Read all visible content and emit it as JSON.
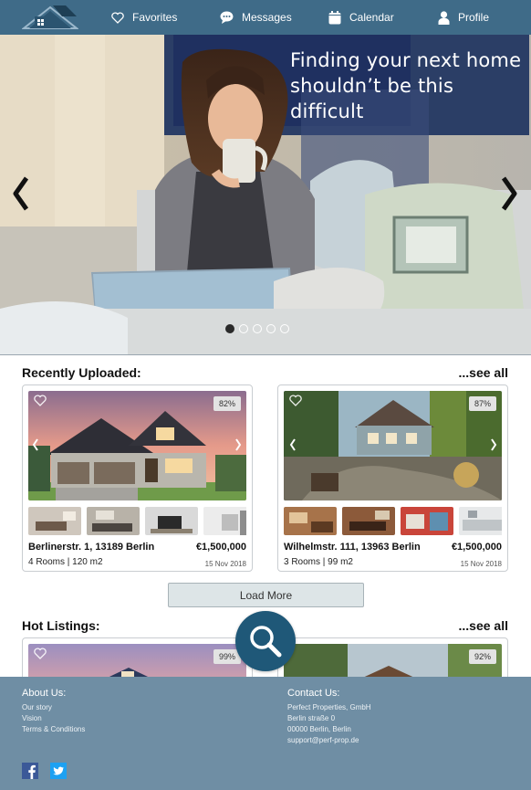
{
  "nav": {
    "items": [
      {
        "label": "Favorites",
        "icon": "heart-icon"
      },
      {
        "label": "Messages",
        "icon": "chat-icon"
      },
      {
        "label": "Calendar",
        "icon": "calendar-icon"
      },
      {
        "label": "Profile",
        "icon": "user-icon"
      }
    ],
    "logo_icon": "house-icon"
  },
  "hero": {
    "title": "Finding your next home shouldn’t be this difficult",
    "slides_total": 5,
    "active_slide": 1,
    "prev_icon": "chevron-left-icon",
    "next_icon": "chevron-right-icon"
  },
  "recent": {
    "title": "Recently Uploaded:",
    "see_all": "...see all",
    "listings": [
      {
        "match": "82%",
        "address": "Berlinerstr. 1, 13189 Berlin",
        "price": "€1,500,000",
        "rooms": "4 Rooms | 120 m2",
        "date": "15 Nov 2018"
      },
      {
        "match": "87%",
        "address": "Wilhelmstr. 111, 13963 Berlin",
        "price": "€1,500,000",
        "rooms": "3 Rooms | 99 m2",
        "date": "15 Nov 2018"
      }
    ]
  },
  "load_more": "Load More",
  "hot": {
    "title": "Hot Listings:",
    "see_all": "...see all",
    "listings": [
      {
        "match": "99%"
      },
      {
        "match": "92%"
      }
    ]
  },
  "footer": {
    "about": {
      "title": "About Us:",
      "links": [
        "Our story",
        "Vision",
        "Terms & Conditions"
      ]
    },
    "contact": {
      "title": "Contact Us:",
      "lines": [
        "Perfect Properties, GmbH",
        "Berlin straße 0",
        "00000 Berlin, Berlin",
        "support@perf-prop.de"
      ]
    },
    "social": [
      "facebook-icon",
      "twitter-icon"
    ]
  },
  "colors": {
    "nav_bg": "#3f6b88",
    "footer_bg": "#6f8ea4",
    "fab_bg": "#1f5878",
    "button_bg": "#dde5e7"
  }
}
